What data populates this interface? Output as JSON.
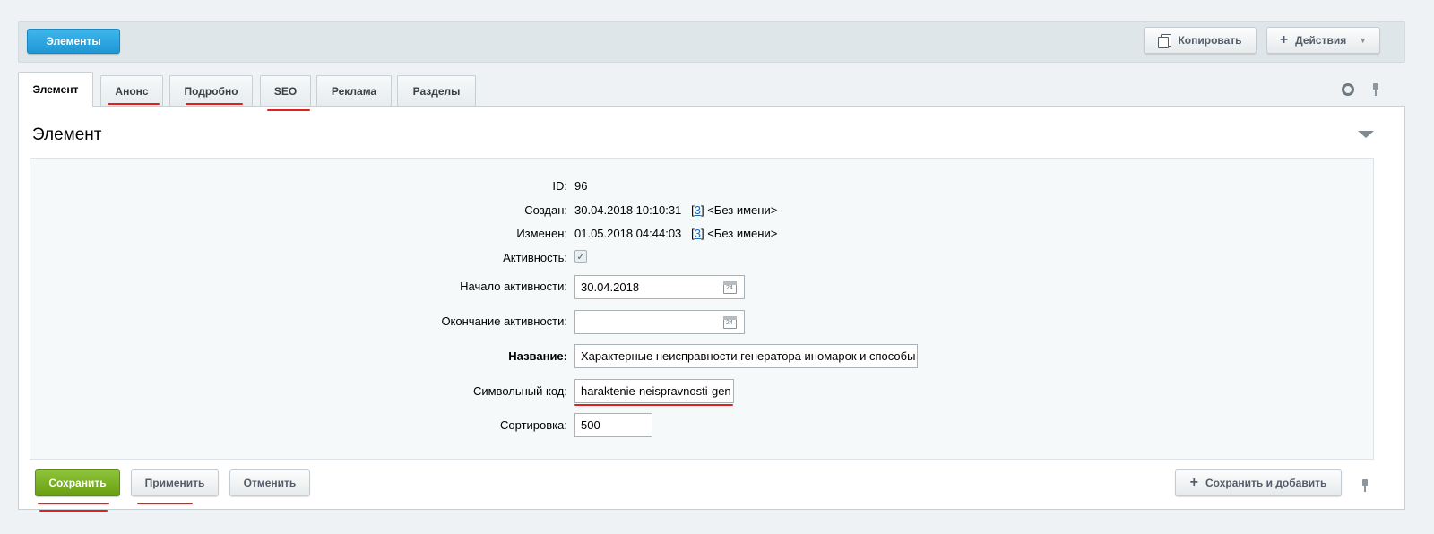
{
  "toolbar": {
    "elements_label": "Элементы",
    "copy_label": "Копировать",
    "actions_label": "Действия"
  },
  "tabs": [
    {
      "label": "Элемент"
    },
    {
      "label": "Анонс"
    },
    {
      "label": "Подробно"
    },
    {
      "label": "SEO"
    },
    {
      "label": "Реклама"
    },
    {
      "label": "Разделы"
    }
  ],
  "panel": {
    "title": "Элемент"
  },
  "form": {
    "id_label": "ID:",
    "id_value": "96",
    "created_label": "Создан:",
    "created_value": "30.04.2018 10:10:31",
    "created_user_id": "3",
    "created_user_name": "<Без имени>",
    "modified_label": "Изменен:",
    "modified_value": "01.05.2018 04:44:03",
    "modified_user_id": "3",
    "modified_user_name": "<Без имени>",
    "active_label": "Активность:",
    "active_from_label": "Начало активности:",
    "active_from_value": "30.04.2018",
    "active_to_label": "Окончание активности:",
    "active_to_value": "",
    "name_label": "Название:",
    "name_value": "Характерные неисправности генератора иномарок и способы",
    "code_label": "Символьный код:",
    "code_value": "haraktenie-neispravnosti-gen",
    "sort_label": "Сортировка:",
    "sort_value": "500"
  },
  "footer": {
    "save_label": "Сохранить",
    "apply_label": "Применить",
    "cancel_label": "Отменить",
    "save_add_label": "Сохранить и добавить"
  },
  "colors": {
    "accent_blue": "#1f97d4",
    "save_green": "#6a9e12",
    "annotation_red": "#e02020",
    "link_blue": "#2067b0"
  }
}
